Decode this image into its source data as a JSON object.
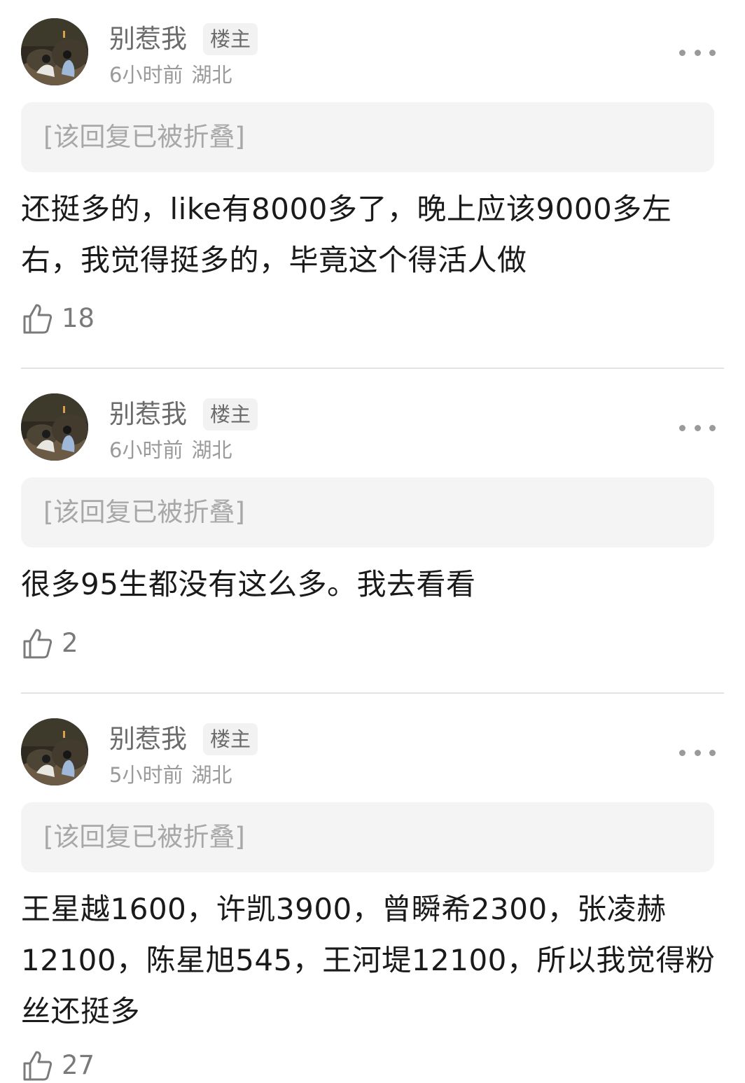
{
  "comments": [
    {
      "username": "别惹我",
      "badge": "楼主",
      "time": "6小时前",
      "location": "湖北",
      "folded_text": "[该回复已被折叠]",
      "content": "还挺多的，like有8000多了，晚上应该9000多左右，我觉得挺多的，毕竟这个得活人做",
      "likes": "18"
    },
    {
      "username": "别惹我",
      "badge": "楼主",
      "time": "6小时前",
      "location": "湖北",
      "folded_text": "[该回复已被折叠]",
      "content": "很多95生都没有这么多。我去看看",
      "likes": "2"
    },
    {
      "username": "别惹我",
      "badge": "楼主",
      "time": "5小时前",
      "location": "湖北",
      "folded_text": "[该回复已被折叠]",
      "content": "王星越1600，许凯3900，曾瞬希2300，张凌赫12100，陈星旭545，王河堤12100，所以我觉得粉丝还挺多",
      "likes": "27"
    }
  ],
  "icons": {
    "like": "thumbs-up-icon",
    "more": "more-dots-icon"
  },
  "colors": {
    "name": "#6b6b6b",
    "meta": "#9a9a9a",
    "folded_bg": "#f4f4f4",
    "folded_text": "#a8a8a8",
    "divider": "#e3e3e3"
  }
}
